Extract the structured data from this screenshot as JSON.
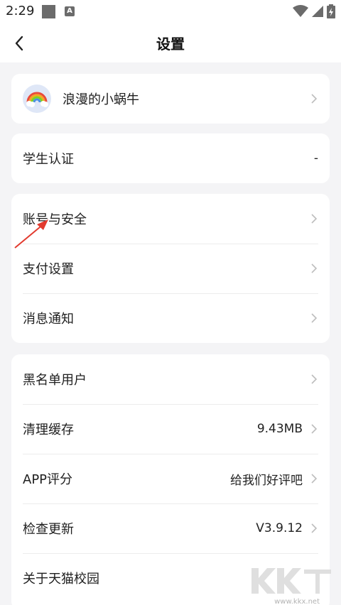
{
  "status_bar": {
    "time": "2:29",
    "notif_icon_letter": "A"
  },
  "nav": {
    "title": "设置"
  },
  "profile": {
    "username": "浪漫的小蜗牛"
  },
  "student": {
    "label": "学生认证",
    "value": "-"
  },
  "group1": [
    {
      "label": "账号与安全"
    },
    {
      "label": "支付设置"
    },
    {
      "label": "消息通知"
    }
  ],
  "group2": [
    {
      "label": "黑名单用户",
      "value": ""
    },
    {
      "label": "清理缓存",
      "value": "9.43MB"
    },
    {
      "label": "APP评分",
      "value": "给我们好评吧"
    },
    {
      "label": "检查更新",
      "value": "V3.9.12"
    },
    {
      "label": "关于天猫校园",
      "value": ""
    }
  ],
  "watermark": {
    "url": "www.kkx.net"
  },
  "colors": {
    "background": "#f4f4f6",
    "card": "#ffffff",
    "annotation_arrow": "#e23a2e",
    "chevron": "#bdbdbd"
  }
}
